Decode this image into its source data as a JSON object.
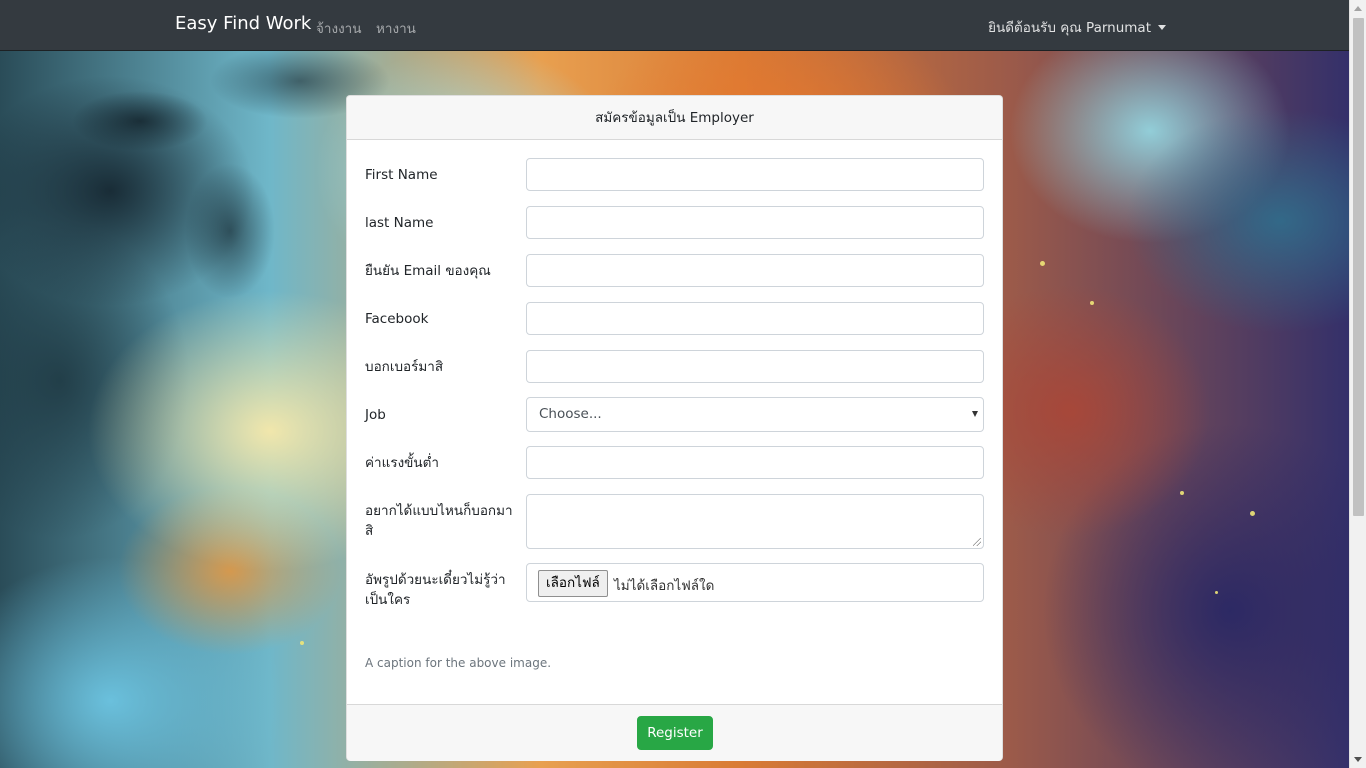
{
  "navbar": {
    "brand": "Easy Find Work",
    "links": [
      {
        "label": "จ้างงาน"
      },
      {
        "label": "หางาน"
      }
    ],
    "user_greeting": "ยินดีต้อนรับ คุณ Parnumat"
  },
  "form": {
    "title": "สมัครข้อมูลเป็น Employer",
    "fields": {
      "first_name": {
        "label": "First Name",
        "value": ""
      },
      "last_name": {
        "label": "last Name",
        "value": ""
      },
      "email": {
        "label": "ยืนยัน Email ของคุณ",
        "value": ""
      },
      "facebook": {
        "label": "Facebook",
        "value": ""
      },
      "phone": {
        "label": "บอกเบอร์มาสิ",
        "value": ""
      },
      "job": {
        "label": "Job",
        "selected": "Choose..."
      },
      "min_wage": {
        "label": "ค่าแรงขั้นต่ำ",
        "value": ""
      },
      "wish": {
        "label": "อยากได้แบบไหนก็บอกมาสิ",
        "value": ""
      },
      "photo": {
        "label": "อัพรูปด้วยนะเดี๋ยวไม่รู้ว่าเป็นใคร",
        "button_label": "เลือกไฟล์",
        "status": "ไม่ได้เลือกไฟล์ใด"
      }
    },
    "caption": "A caption for the above image.",
    "submit_label": "Register"
  },
  "colors": {
    "navbar_bg": "#343a40",
    "submit_bg": "#28a745"
  }
}
